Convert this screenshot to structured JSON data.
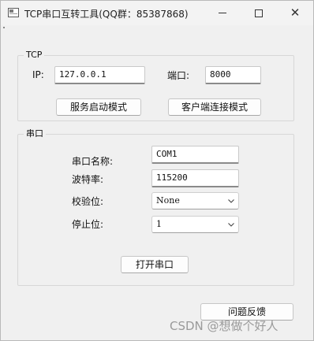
{
  "window": {
    "title": "TCP串口互转工具(QQ群：85387868)",
    "controls": {
      "minimize_icon": "minimize-icon",
      "maximize_icon": "maximize-icon",
      "close_glyph": "✕"
    }
  },
  "tcp": {
    "group_title": "TCP",
    "ip_label": "IP:",
    "ip_value": "127.0.0.1",
    "port_label": "端口:",
    "port_value": "8000",
    "server_button": "服务启动模式",
    "client_button": "客户端连接模式"
  },
  "serial": {
    "group_title": "串口",
    "port_name_label": "串口名称:",
    "port_name_value": "COM1",
    "baud_label": "波特率:",
    "baud_value": "115200",
    "parity_label": "校验位:",
    "parity_value": "None",
    "stopbits_label": "停止位:",
    "stopbits_value": "1",
    "open_button": "打开串口"
  },
  "feedback_button": "问题反馈",
  "watermark": "CSDN @想做个好人",
  "colors": {
    "window_bg": "#f0f0f0",
    "input_bg": "#ffffff",
    "border": "#c9c9c9",
    "watermark": "#9a9a9a"
  }
}
